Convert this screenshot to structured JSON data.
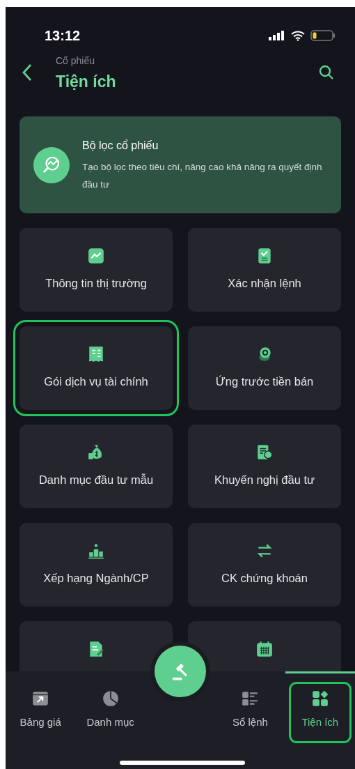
{
  "status_bar": {
    "time": "13:12"
  },
  "header": {
    "subtitle": "Cổ phiếu",
    "title": "Tiện ích"
  },
  "banner": {
    "title": "Bộ lọc cổ phiếu",
    "description": "Tạo bộ lọc theo tiêu chí, nâng cao khả năng ra quyết định đầu tư"
  },
  "tiles": [
    {
      "label": "Thông tin thị trường",
      "highlighted": false
    },
    {
      "label": "Xác nhận lệnh",
      "highlighted": false
    },
    {
      "label": "Gói dịch vụ tài chính",
      "highlighted": true
    },
    {
      "label": "Ứng trước tiền bán",
      "highlighted": false
    },
    {
      "label": "Danh mục đầu tư mẫu",
      "highlighted": false
    },
    {
      "label": "Khuyến nghị đầu tư",
      "highlighted": false
    },
    {
      "label": "Xếp hạng Ngành/CP",
      "highlighted": false
    },
    {
      "label": "CK chứng khoán",
      "highlighted": false
    },
    {
      "highlighted": false
    },
    {
      "highlighted": false
    }
  ],
  "bottom_nav": [
    {
      "label": "Bảng giá",
      "selected": false,
      "highlighted": false
    },
    {
      "label": "Danh mục",
      "selected": false,
      "highlighted": false
    },
    {
      "kind": "fab"
    },
    {
      "label": "Sổ lệnh",
      "selected": false,
      "highlighted": false
    },
    {
      "label": "Tiện ích",
      "selected": true,
      "highlighted": true
    }
  ]
}
